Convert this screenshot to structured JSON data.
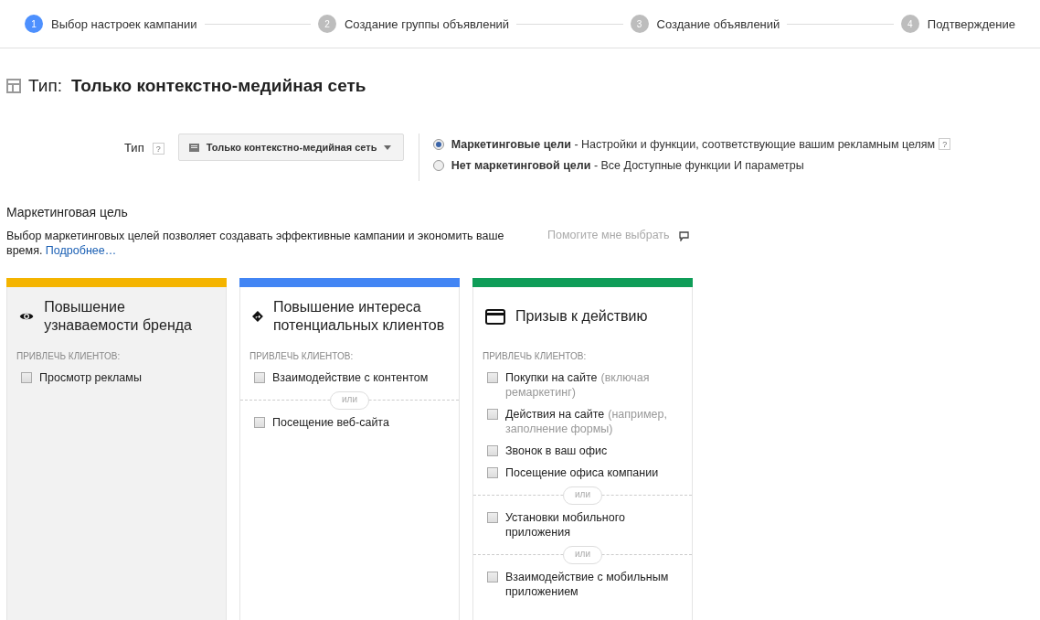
{
  "steps": [
    {
      "number": "1",
      "label": "Выбор настроек кампании",
      "selected": true
    },
    {
      "number": "2",
      "label": "Создание группы объявлений",
      "selected": false
    },
    {
      "number": "3",
      "label": "Создание объявлений",
      "selected": false
    },
    {
      "number": "4",
      "label": "Подтверждение",
      "selected": false
    }
  ],
  "heading": {
    "prefix": "Тип:",
    "title": "Только контекстно-медийная сеть"
  },
  "type_row": {
    "label": "Тип",
    "help": "?",
    "dropdown": "Только контекстно-медийная сеть",
    "radios": [
      {
        "label": "Маркетинговые цели",
        "description": " - Настройки и функции, соответствующие вашим рекламным целям",
        "help": "?",
        "selected": true
      },
      {
        "label": "Нет маркетинговой цели",
        "description": " - Все Доступные функции И параметры",
        "selected": false
      }
    ]
  },
  "goal": {
    "title": "Маркетинговая цель",
    "description": "Выбор маркетинговых целей позволяет создавать эффективные кампании и экономить ваше время.",
    "link": "Подробнее…",
    "help_link": "Помогите мне выбрать"
  },
  "cards": [
    {
      "title": "Повышение узнаваемости бренда",
      "color": "#f4b400",
      "selected": true,
      "section_label": "ПРИВЛЕЧЬ КЛИЕНТОВ:",
      "groups": [
        {
          "options": [
            {
              "label": "Просмотр рекламы",
              "checked": false
            }
          ]
        }
      ]
    },
    {
      "title": "Повышение интереса потенциальных клиентов",
      "color": "#4285f4",
      "selected": false,
      "section_label": "ПРИВЛЕЧЬ КЛИЕНТОВ:",
      "groups": [
        {
          "options": [
            {
              "label": "Взаимодействие с контентом",
              "checked": false
            }
          ]
        },
        {
          "separator": "или",
          "options": [
            {
              "label": "Посещение веб-сайта",
              "checked": false
            }
          ]
        }
      ]
    },
    {
      "title": "Призыв к действию",
      "color": "#0f9d58",
      "selected": false,
      "section_label": "ПРИВЛЕЧЬ КЛИЕНТОВ:",
      "groups": [
        {
          "options": [
            {
              "label": "Покупки на сайте",
              "note": "(включая ремаркетинг)",
              "checked": false
            },
            {
              "label": "Действия на сайте",
              "note": "(например, заполнение формы)",
              "checked": false
            },
            {
              "label": "Звонок в ваш офис",
              "checked": false
            },
            {
              "label": "Посещение офиса компании",
              "checked": false
            }
          ]
        },
        {
          "separator": "или",
          "options": [
            {
              "label": "Установки мобильного приложения",
              "checked": false
            }
          ]
        },
        {
          "separator": "или",
          "options": [
            {
              "label": "Взаимодействие с мобильным приложением",
              "checked": false
            }
          ]
        }
      ]
    }
  ]
}
